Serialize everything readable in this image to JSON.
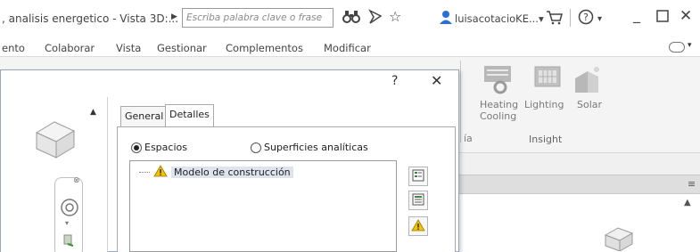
{
  "titlebar": {
    "title": ", analisis energetico - Vista 3D:...",
    "search_placeholder": "Escriba palabra clave o frase",
    "user": "luisacotacioKE...",
    "user_arrow": "▾",
    "help_arrow": "▾"
  },
  "menubar": {
    "items": [
      "ento",
      "Colaborar",
      "Vista",
      "Gestionar",
      "Complementos",
      "Modificar"
    ]
  },
  "ribbon": {
    "buttons": [
      {
        "label_line1": "Heating",
        "label_line2": "Cooling"
      },
      {
        "label_line1": "Lighting",
        "label_line2": ""
      },
      {
        "label_line1": "Solar",
        "label_line2": ""
      }
    ],
    "panel_label": "Insight",
    "partial_label": "ía"
  },
  "dialog": {
    "help": "?",
    "close": "✕",
    "tabs": [
      "General",
      "Detalles"
    ],
    "active_tab": "Detalles",
    "radio_options": [
      {
        "label": "Espacios",
        "checked": true
      },
      {
        "label": "Superficies analíticas",
        "checked": false
      }
    ],
    "tree_root": "Modelo de construcción"
  },
  "colors": {
    "warning": "#f2c200",
    "selection": "#dde4ee",
    "ribbon_bg": "#f4f4f4"
  }
}
